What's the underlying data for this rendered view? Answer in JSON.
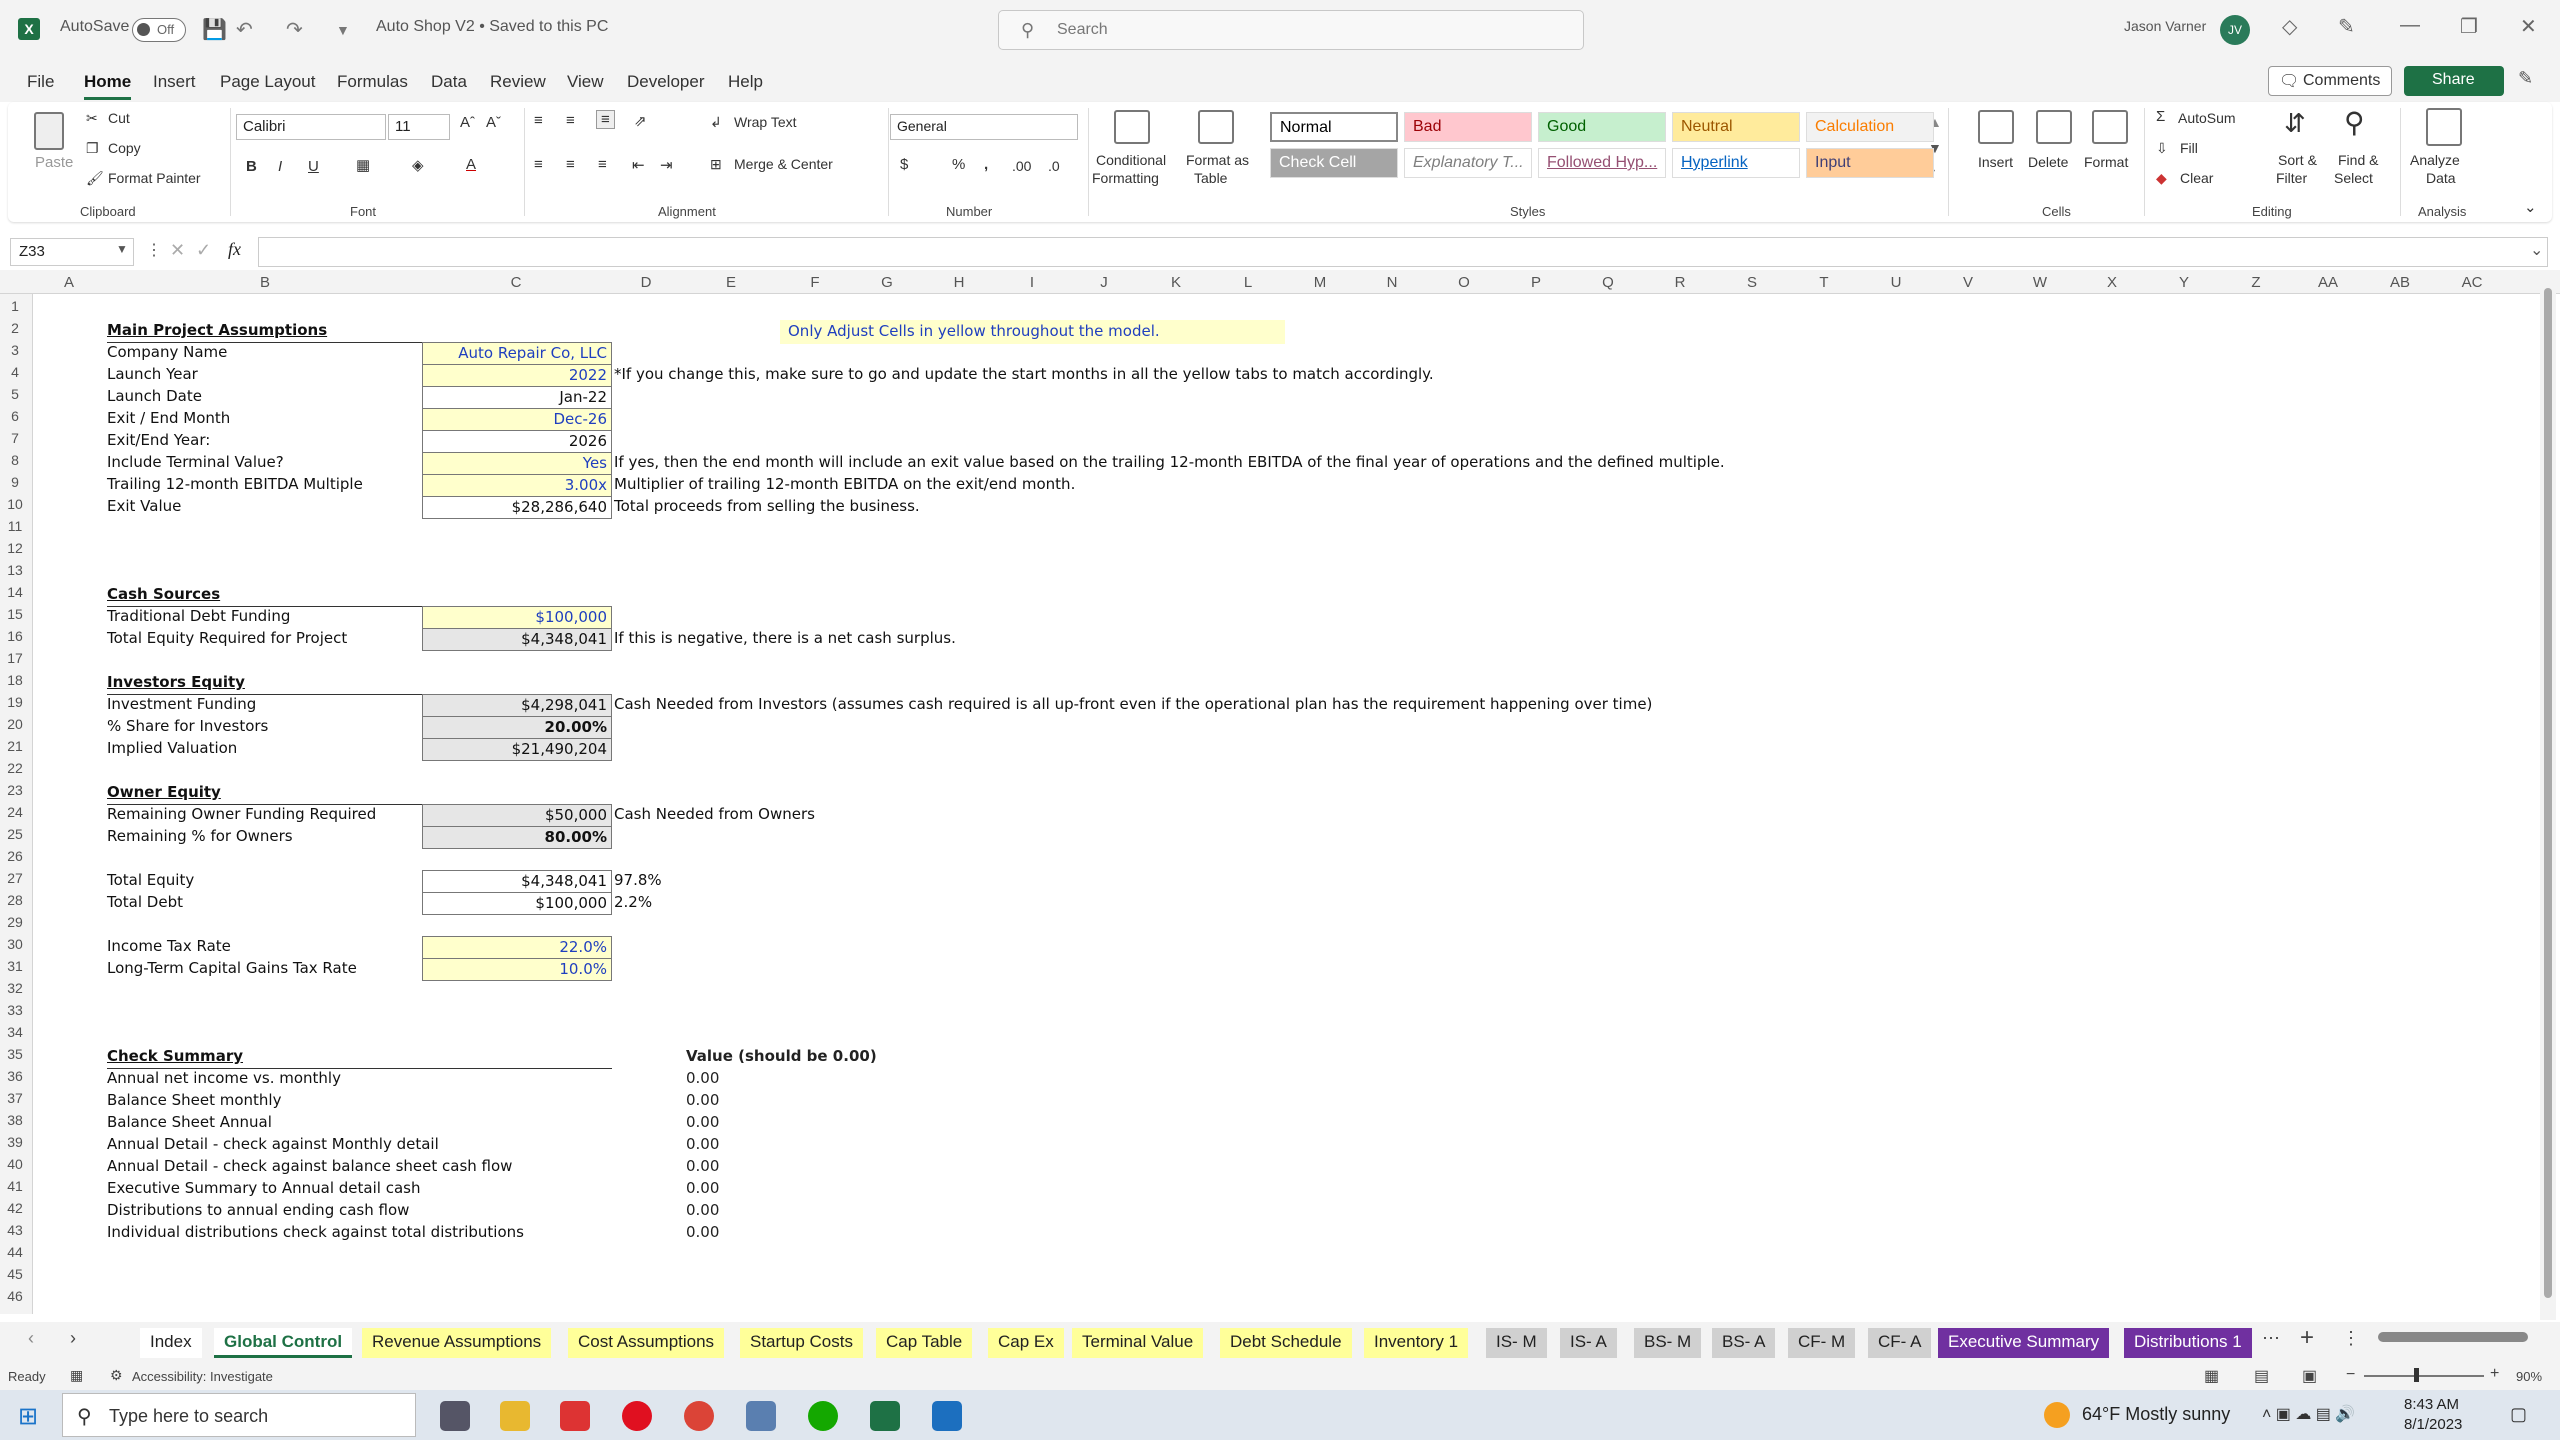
{
  "window": {
    "autosave_label": "AutoSave",
    "autosave_state": "Off",
    "doc_title": "Auto Shop V2 • Saved to this PC",
    "search_placeholder": "Search",
    "user_name": "Jason Varner",
    "user_initials": "JV"
  },
  "menu": [
    "File",
    "Home",
    "Insert",
    "Page Layout",
    "Formulas",
    "Data",
    "Review",
    "View",
    "Developer",
    "Help"
  ],
  "menu_active": "Home",
  "header_buttons": {
    "comments": "Comments",
    "share": "Share"
  },
  "ribbon": {
    "clipboard": {
      "paste": "Paste",
      "cut": "Cut",
      "copy": "Copy",
      "format_painter": "Format Painter",
      "group": "Clipboard"
    },
    "font": {
      "name": "Calibri",
      "size": "11",
      "group": "Font"
    },
    "alignment": {
      "wrap_text": "Wrap Text",
      "merge_center": "Merge & Center",
      "group": "Alignment"
    },
    "number": {
      "format": "General",
      "group": "Number"
    },
    "styles": {
      "conditional_formatting_1": "Conditional",
      "conditional_formatting_2": "Formatting",
      "format_as_table_1": "Format as",
      "format_as_table_2": "Table",
      "gallery": [
        {
          "label": "Normal",
          "bg": "#ffffff",
          "fg": "#000000"
        },
        {
          "label": "Bad",
          "bg": "#ffc7ce",
          "fg": "#9c0006"
        },
        {
          "label": "Good",
          "bg": "#c6efce",
          "fg": "#006100"
        },
        {
          "label": "Neutral",
          "bg": "#ffeb9c",
          "fg": "#9c5700"
        },
        {
          "label": "Calculation",
          "bg": "#f2f2f2",
          "fg": "#fa7d00"
        },
        {
          "label": "Check Cell",
          "bg": "#a5a5a5",
          "fg": "#ffffff"
        },
        {
          "label": "Explanatory T...",
          "bg": "#ffffff",
          "fg": "#7f7f7f"
        },
        {
          "label": "Followed Hyp...",
          "bg": "#ffffff",
          "fg": "#954f72"
        },
        {
          "label": "Hyperlink",
          "bg": "#ffffff",
          "fg": "#0563c1"
        },
        {
          "label": "Input",
          "bg": "#ffcc99",
          "fg": "#3f3f76"
        }
      ],
      "group": "Styles"
    },
    "cells": {
      "insert": "Insert",
      "delete": "Delete",
      "format": "Format",
      "group": "Cells"
    },
    "editing": {
      "autosum": "AutoSum",
      "fill": "Fill",
      "clear": "Clear",
      "sort_filter_1": "Sort &",
      "sort_filter_2": "Filter",
      "find_select_1": "Find &",
      "find_select_2": "Select",
      "group": "Editing"
    },
    "analysis": {
      "analyze_data_1": "Analyze",
      "analyze_data_2": "Data",
      "group": "Analysis"
    }
  },
  "formula_bar": {
    "name_box": "Z33",
    "fx": "fx",
    "formula": ""
  },
  "columns": [
    "A",
    "B",
    "C",
    "D",
    "E",
    "F",
    "G",
    "H",
    "I",
    "J",
    "K",
    "L",
    "M",
    "N",
    "O",
    "P",
    "Q",
    "R",
    "S",
    "T",
    "U",
    "V",
    "W",
    "X",
    "Y",
    "Z",
    "AA",
    "AB",
    "AC"
  ],
  "rows": [
    "1",
    "2",
    "3",
    "4",
    "5",
    "6",
    "7",
    "8",
    "9",
    "10",
    "11",
    "12",
    "13",
    "14",
    "15",
    "16",
    "17",
    "18",
    "19",
    "20",
    "21",
    "22",
    "23",
    "24",
    "25",
    "26",
    "27",
    "28",
    "29",
    "30",
    "31",
    "32",
    "33",
    "34",
    "35",
    "36",
    "37",
    "38",
    "39",
    "40",
    "41",
    "42",
    "43",
    "44",
    "45",
    "46"
  ],
  "banner": "Only Adjust Cells in yellow throughout the model.",
  "sheet": {
    "main_header": "Main Project Assumptions",
    "assumptions": [
      {
        "row": 3,
        "label": "Company Name",
        "value": "Auto Repair Co, LLC",
        "style": "yellow",
        "note": ""
      },
      {
        "row": 4,
        "label": "Launch Year",
        "value": "2022",
        "style": "yellow",
        "note": "*If you change this, make sure to go and update the start months in all the yellow tabs to match accordingly."
      },
      {
        "row": 5,
        "label": "Launch Date",
        "value": "Jan-22",
        "style": "white",
        "note": ""
      },
      {
        "row": 6,
        "label": "Exit / End Month",
        "value": "Dec-26",
        "style": "yellow",
        "note": ""
      },
      {
        "row": 7,
        "label": "Exit/End Year:",
        "value": "2026",
        "style": "white",
        "note": ""
      },
      {
        "row": 8,
        "label": "Include Terminal Value?",
        "value": "Yes",
        "style": "yellow",
        "note": "If yes, then the end month will include an exit value based on the trailing 12-month EBITDA of the final year of operations and the defined multiple."
      },
      {
        "row": 9,
        "label": "Trailing 12-month EBITDA Multiple",
        "value": "3.00x",
        "style": "yellow",
        "note": "Multiplier of trailing 12-month EBITDA on the exit/end month."
      },
      {
        "row": 10,
        "label": "Exit Value",
        "value": "$28,286,640",
        "style": "white",
        "note": "Total proceeds from selling the business."
      }
    ],
    "cash_header": "Cash Sources",
    "cash": [
      {
        "row": 15,
        "label": "Traditional Debt Funding",
        "value": "$100,000",
        "style": "yellow",
        "note": ""
      },
      {
        "row": 16,
        "label": "Total Equity Required for Project",
        "value": "$4,348,041",
        "style": "gray",
        "note": "If this is negative, there is a net cash surplus."
      }
    ],
    "investors_header": "Investors Equity",
    "investors": [
      {
        "row": 19,
        "label": "Investment Funding",
        "value": "$4,298,041",
        "style": "gray",
        "note": "Cash Needed from Investors (assumes cash required is all up-front even if the operational plan has the requirement happening over time)"
      },
      {
        "row": 20,
        "label": "% Share for Investors",
        "value": "20.00%",
        "style": "gray bold",
        "note": ""
      },
      {
        "row": 21,
        "label": "Implied Valuation",
        "value": "$21,490,204",
        "style": "gray",
        "note": ""
      }
    ],
    "owner_header": "Owner Equity",
    "owner": [
      {
        "row": 24,
        "label": "Remaining Owner Funding Required",
        "value": "$50,000",
        "style": "gray",
        "note": "Cash Needed from Owners"
      },
      {
        "row": 25,
        "label": "Remaining % for Owners",
        "value": "80.00%",
        "style": "gray bold",
        "note": ""
      }
    ],
    "totals": [
      {
        "row": 27,
        "label": "Total Equity",
        "value": "$4,348,041",
        "style": "white",
        "note": "97.8%"
      },
      {
        "row": 28,
        "label": "Total Debt",
        "value": "$100,000",
        "style": "white",
        "note": "2.2%"
      }
    ],
    "tax": [
      {
        "row": 30,
        "label": "Income Tax Rate",
        "value": "22.0%",
        "style": "yellow",
        "note": ""
      },
      {
        "row": 31,
        "label": "Long-Term Capital Gains Tax Rate",
        "value": "10.0%",
        "style": "yellow",
        "note": ""
      }
    ],
    "check_header": "Check Summary",
    "check_value_header": "Value (should be 0.00)",
    "checks": [
      {
        "row": 36,
        "label": "Annual net income vs. monthly",
        "value": "0.00"
      },
      {
        "row": 37,
        "label": "Balance Sheet monthly",
        "value": "0.00"
      },
      {
        "row": 38,
        "label": "Balance Sheet Annual",
        "value": "0.00"
      },
      {
        "row": 39,
        "label": "Annual Detail - check against Monthly detail",
        "value": "0.00"
      },
      {
        "row": 40,
        "label": "Annual Detail - check against balance sheet cash flow",
        "value": "0.00"
      },
      {
        "row": 41,
        "label": "Executive Summary to Annual detail cash",
        "value": "0.00"
      },
      {
        "row": 42,
        "label": "Distributions to annual ending cash flow",
        "value": "0.00"
      },
      {
        "row": 43,
        "label": "Individual distributions check against total distributions",
        "value": "0.00"
      }
    ]
  },
  "tabs": [
    {
      "label": "Index",
      "bg": "#ffffff",
      "fg": "#222222"
    },
    {
      "label": "Global Control",
      "bg": "#ffffff",
      "fg": "#1e7145",
      "active": true
    },
    {
      "label": "Revenue Assumptions",
      "bg": "#ffff99",
      "fg": "#222222"
    },
    {
      "label": "Cost Assumptions",
      "bg": "#ffff99",
      "fg": "#222222"
    },
    {
      "label": "Startup Costs",
      "bg": "#ffff99",
      "fg": "#222222"
    },
    {
      "label": "Cap Table",
      "bg": "#ffff99",
      "fg": "#222222"
    },
    {
      "label": "Cap Ex",
      "bg": "#ffff99",
      "fg": "#222222"
    },
    {
      "label": "Terminal Value",
      "bg": "#ffff99",
      "fg": "#222222"
    },
    {
      "label": "Debt Schedule",
      "bg": "#ffff99",
      "fg": "#222222"
    },
    {
      "label": "Inventory 1",
      "bg": "#ffff99",
      "fg": "#222222"
    },
    {
      "label": "IS- M",
      "bg": "#d0d0d0",
      "fg": "#222222"
    },
    {
      "label": "IS- A",
      "bg": "#d0d0d0",
      "fg": "#222222"
    },
    {
      "label": "BS- M",
      "bg": "#d0d0d0",
      "fg": "#222222"
    },
    {
      "label": "BS- A",
      "bg": "#d0d0d0",
      "fg": "#222222"
    },
    {
      "label": "CF- M",
      "bg": "#d0d0d0",
      "fg": "#222222"
    },
    {
      "label": "CF- A",
      "bg": "#d0d0d0",
      "fg": "#222222"
    },
    {
      "label": "Executive Summary",
      "bg": "#7030a0",
      "fg": "#ffffff"
    },
    {
      "label": "Distributions 1",
      "bg": "#7030a0",
      "fg": "#ffffff"
    }
  ],
  "status": {
    "ready": "Ready",
    "accessibility": "Accessibility: Investigate",
    "zoom": "90%"
  },
  "taskbar": {
    "search_placeholder": "Type here to search",
    "weather": "64°F  Mostly sunny",
    "time": "8:43 AM",
    "date": "8/1/2023"
  }
}
